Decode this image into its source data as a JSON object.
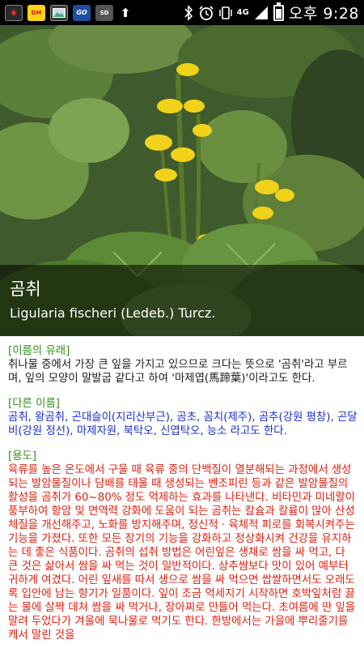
{
  "status_bar": {
    "time": "오후 9:28",
    "network": "4G",
    "icons": [
      "camera-icon",
      "cjk-app-icon",
      "gallery-icon",
      "game-icon",
      "sd-card-icon",
      "download-icon",
      "bluetooth-icon",
      "alarm-icon",
      "vibrate-icon",
      "signal-icon",
      "battery-icon"
    ]
  },
  "hero": {
    "name": "곰취",
    "scientific_name": "Ligularia fischeri (Ledeb.) Turcz."
  },
  "sections": [
    {
      "heading": "[이름의 유래]",
      "body": "취나물 중에서 가장 큰 잎을 가지고 있으므로 크다는 뜻으로 '곰취'라고 부르며, 잎의 모양이 말발굽 같다고 하여 '마제엽(馬蹄葉)'이라고도 한다."
    },
    {
      "heading": "[다른 이름]",
      "body": "곰취, 왕곰취, 곤대슬이(지리산부근), 곰초, 꼼치(제주), 곰추(강원 평창), 곤달비(강원 정선), 마제자원, 북탁오, 신엽탁오, 능소 라고도 한다."
    },
    {
      "heading": "[용도]",
      "body": "육류를 높은 온도에서 구울 때 육류 중의 단백질이 열분해되는 과정에서 생성되는 발암물질이나 담배를 태울 때 생성되는 벤조피린 등과 같은 발암물질의 활성을 곰취가 60~80% 정도 억제하는 효과를 나타낸다. 비타민과 미네랄이 풍부하여 항암 및 면역력 강화에 도움이 되는 곰취는 칼슘과 칼륨이 많아 산성 체질을 개선해주고, 노화를 방지해주며, 정신적 · 육체적 피로를 회복시켜주는 기능을 가졌다. 또한 모든 장기의 기능을 강화하고 정상화시켜 건강을 유지하는 데 좋은 식품이다. 곰취의 섭취 방법은 어린잎은 생채로 쌈을 싸 먹고, 다 큰 것은 삶아서 쌈을 싸 먹는 것이 일반적이다. 상추쌈보다 맛이 있어 예부터 귀하게 여겼다. 어린 잎새를 따서 생으로 쌈을 싸 먹으면 쌉쌀하면서도 오래도록 입안에 남는 향기가 일품이다. 잎이 조금 억세지기 시작하면 호박잎처럼 끓는 물에 살짝 데쳐 쌈을 싸 먹거나, 장아찌로 만들어 먹는다. 초여름에 딴 잎을 말려 두었다가 겨울에 묵나물로 먹기도 한다. 한방에서는 가을에 뿌리줄기를 캐서 말린 것을"
    }
  ],
  "colors": {
    "heading": "#2f8f1b",
    "names": "#1a2fd0",
    "usage": "#e02010"
  }
}
